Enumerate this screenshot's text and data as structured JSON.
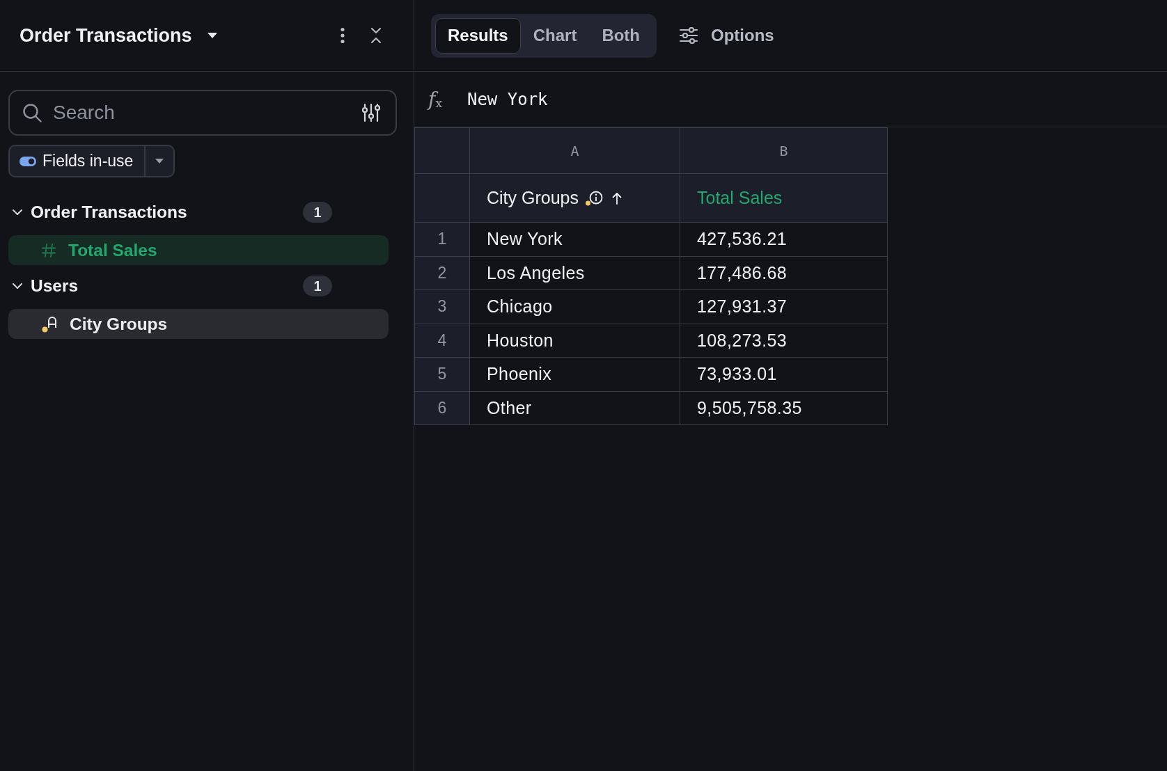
{
  "panel": {
    "title": "Order Transactions"
  },
  "search": {
    "placeholder": "Search"
  },
  "filter": {
    "label": "Fields in-use",
    "on": true
  },
  "groups": [
    {
      "name": "Order Transactions",
      "count": "1",
      "expanded": true,
      "fields": [
        {
          "name": "Total Sales",
          "kind": "measure"
        }
      ]
    },
    {
      "name": "Users",
      "count": "1",
      "expanded": true,
      "fields": [
        {
          "name": "City Groups",
          "kind": "dimension"
        }
      ]
    }
  ],
  "view_tabs": [
    {
      "label": "Results",
      "selected": true
    },
    {
      "label": "Chart",
      "selected": false
    },
    {
      "label": "Both",
      "selected": false
    }
  ],
  "options": {
    "label": "Options"
  },
  "formula_bar": {
    "symbol": "f$_{x}$",
    "value": "New York"
  },
  "table": {
    "column_letters": [
      "A",
      "B"
    ],
    "columns": [
      {
        "label": "City Groups",
        "kind": "dimension",
        "sorted_ascending": true
      },
      {
        "label": "Total Sales",
        "kind": "measure",
        "sorted_ascending": false
      }
    ],
    "rows": [
      {
        "number": "1",
        "cells": [
          "New York",
          "427,536.21"
        ]
      },
      {
        "number": "2",
        "cells": [
          "Los Angeles",
          "177,486.68"
        ]
      },
      {
        "number": "3",
        "cells": [
          "Chicago",
          "127,931.37"
        ]
      },
      {
        "number": "4",
        "cells": [
          "Houston",
          "108,273.53"
        ]
      },
      {
        "number": "5",
        "cells": [
          "Phoenix",
          "73,933.01"
        ]
      },
      {
        "number": "6",
        "cells": [
          "Other",
          "9,505,758.35"
        ]
      }
    ]
  }
}
